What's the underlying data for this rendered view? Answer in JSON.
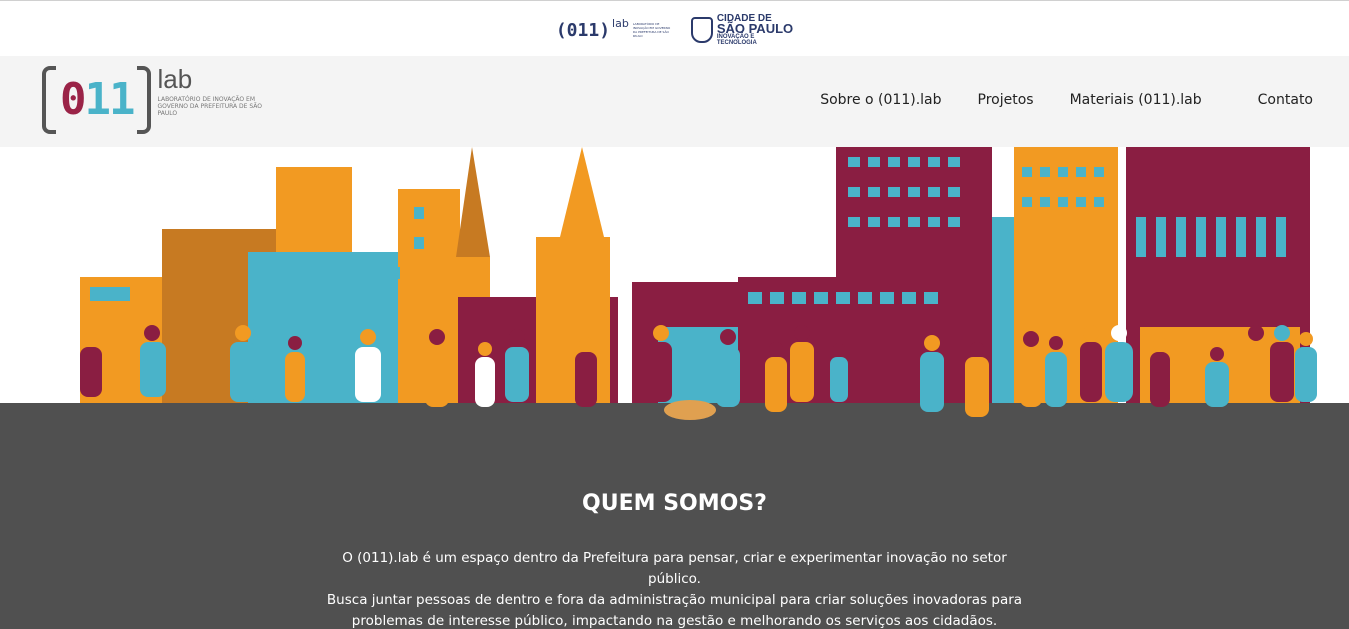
{
  "topbar": {
    "partner_logo": {
      "mark": "(011)",
      "lab": "lab",
      "subtitle": "LABORATÓRIO DE INOVAÇÃO EM GOVERNO DA PREFEITURA DE SÃO PAULO"
    },
    "city_logo": {
      "line1": "CIDADE DE",
      "line2": "SÃO PAULO",
      "line3": "INOVAÇÃO E",
      "line4": "TECNOLOGIA"
    }
  },
  "header": {
    "logo": {
      "mark_zero": "0",
      "mark_ones": "11",
      "lab": "lab",
      "description": "LABORATÓRIO DE INOVAÇÃO EM GOVERNO DA PREFEITURA DE SÃO PAULO"
    },
    "nav": [
      {
        "label": "Sobre o (011).lab"
      },
      {
        "label": "Projetos"
      },
      {
        "label": "Materiais (011).lab"
      },
      {
        "label": "Contato"
      }
    ]
  },
  "about": {
    "title": "QUEM SOMOS?",
    "lines": [
      "O (011).lab é um espaço dentro da Prefeitura para pensar, criar e experimentar inovação no setor público.",
      "Busca juntar pessoas de dentro e fora da administração municipal para criar soluções inovadoras para",
      "problemas de interesse público, impactando na gestão e melhorando os serviços aos cidadãos."
    ]
  },
  "colors": {
    "orange": "#f29a22",
    "teal": "#4ab3c9",
    "maroon": "#8a1e42",
    "gray_dark": "#505050",
    "nav_text": "#222222"
  }
}
